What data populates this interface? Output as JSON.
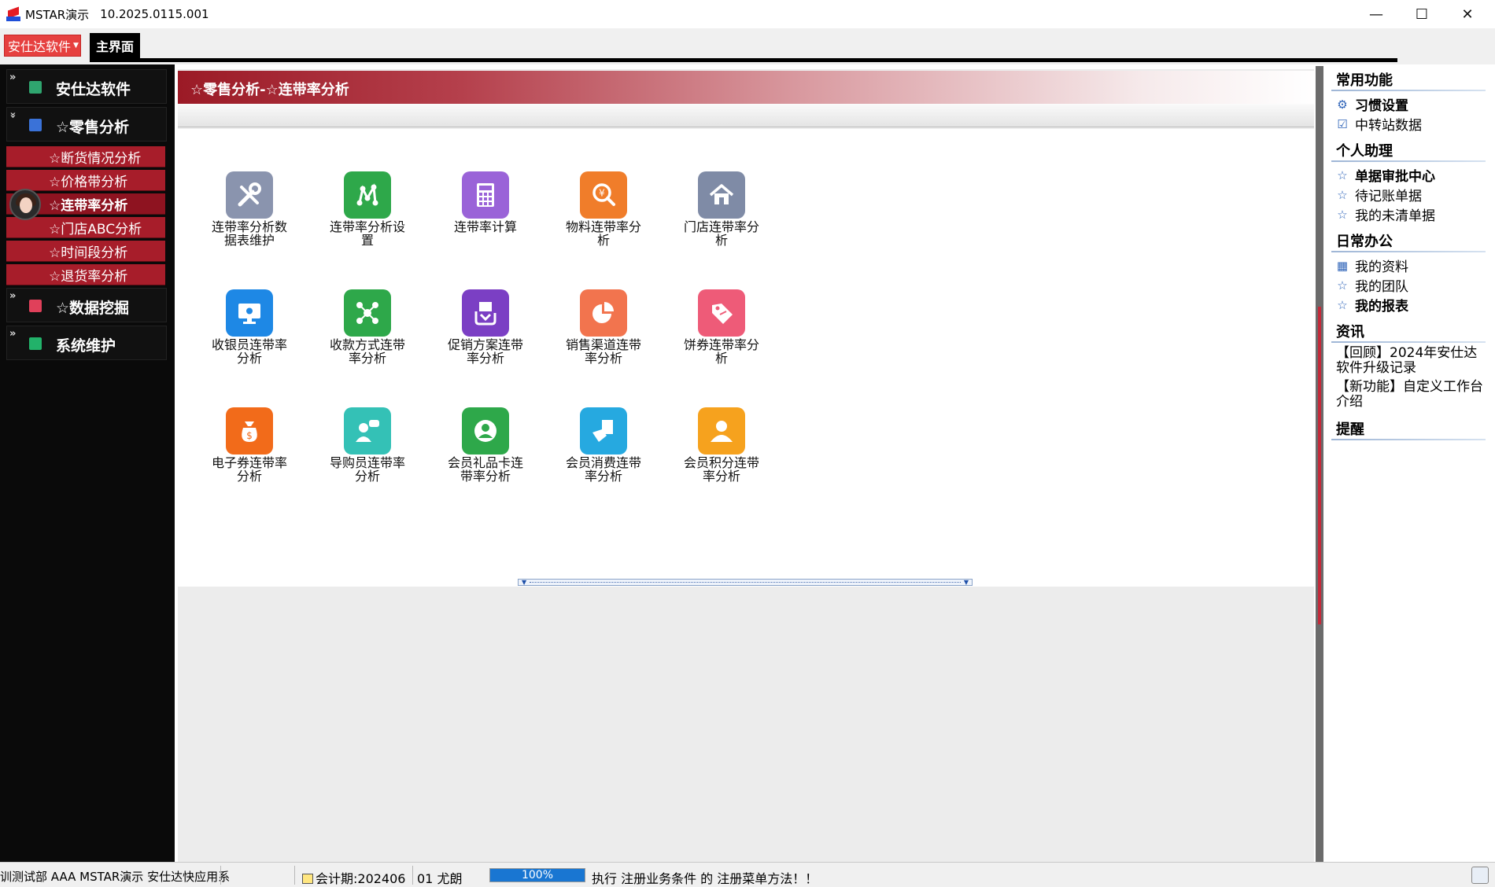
{
  "window": {
    "title": "MSTAR演示",
    "version": "10.2025.0115.001",
    "minimize": "—",
    "maximize": "☐",
    "close": "✕"
  },
  "toolbar": {
    "company_menu": "安仕达软件",
    "main_tab": "主界面"
  },
  "sidebar": {
    "groups": [
      {
        "label": "安仕达软件",
        "icon": "app-icon",
        "color": "#2fa56f"
      },
      {
        "label": "☆零售分析",
        "icon": "chart-icon",
        "color": "#3a72d8"
      },
      {
        "label": "☆数据挖掘",
        "icon": "mining-icon",
        "color": "#e0405a"
      },
      {
        "label": "系统维护",
        "icon": "maintenance-icon",
        "color": "#22b26a"
      }
    ],
    "items": [
      {
        "label": "☆断货情况分析"
      },
      {
        "label": "☆价格带分析"
      },
      {
        "label": "☆连带率分析"
      },
      {
        "label": "☆门店ABC分析"
      },
      {
        "label": "☆时间段分析"
      },
      {
        "label": "☆退货率分析"
      }
    ],
    "active_item": "☆连带率分析"
  },
  "main": {
    "header_title": "☆零售分析-☆连带率分析",
    "tiles": [
      {
        "label": "连带率分析数据表维护",
        "icon": "tools-icon",
        "color": "#8a94ae"
      },
      {
        "label": "连带率分析设置",
        "icon": "network-icon",
        "color": "#2ea84a"
      },
      {
        "label": "连带率计算",
        "icon": "calculator-icon",
        "color": "#9a63d8"
      },
      {
        "label": "物料连带率分析",
        "icon": "yuan-search-icon",
        "color": "#f07d2a"
      },
      {
        "label": "门店连带率分析",
        "icon": "store-icon",
        "color": "#7f8ba6"
      },
      {
        "label": "收银员连带率分析",
        "icon": "monitor-icon",
        "color": "#1e88e5"
      },
      {
        "label": "收款方式连带率分析",
        "icon": "nodes-icon",
        "color": "#2ea84a"
      },
      {
        "label": "促销方案连带率分析",
        "icon": "hand-cash-icon",
        "color": "#7b3fc4"
      },
      {
        "label": "销售渠道连带率分析",
        "icon": "pie-icon",
        "color": "#f2744e"
      },
      {
        "label": "饼券连带率分析",
        "icon": "tag-icon",
        "color": "#ee5b78"
      },
      {
        "label": "电子券连带率分析",
        "icon": "money-bag-icon",
        "color": "#f26b1a"
      },
      {
        "label": "导购员连带率分析",
        "icon": "guide-icon",
        "color": "#34c1b6"
      },
      {
        "label": "会员礼品卡连带率分析",
        "icon": "member-card-icon",
        "color": "#2ea84a"
      },
      {
        "label": "会员消费连带率分析",
        "icon": "member-spend-icon",
        "color": "#26a9e0"
      },
      {
        "label": "会员积分连带率分析",
        "icon": "member-points-icon",
        "color": "#f6a21e"
      }
    ]
  },
  "right_panel": {
    "sections": [
      {
        "title": "常用功能",
        "items": [
          {
            "label": "习惯设置",
            "icon": "link-gear-icon",
            "bold": true
          },
          {
            "label": "中转站数据",
            "icon": "checkbox-icon",
            "bold": false
          }
        ]
      },
      {
        "title": "个人助理",
        "items": [
          {
            "label": "单据审批中心",
            "icon": "star-icon",
            "bold": true
          },
          {
            "label": "待记账单据",
            "icon": "star-icon",
            "bold": false
          },
          {
            "label": "我的未清单据",
            "icon": "star-icon",
            "bold": false
          }
        ]
      },
      {
        "title": "日常办公",
        "items": [
          {
            "label": "我的资料",
            "icon": "calendar-icon",
            "bold": false
          },
          {
            "label": "我的团队",
            "icon": "star-icon",
            "bold": false
          },
          {
            "label": "我的报表",
            "icon": "star-icon",
            "bold": true
          }
        ]
      }
    ],
    "news_title": "资讯",
    "news": [
      "【回顾】2024年安仕达软件升级记录",
      "【新功能】自定义工作台介绍"
    ],
    "reminder_title": "提醒"
  },
  "statusbar": {
    "left": "训测试部 AAA MSTAR演示 安仕达快应用系",
    "period": "会计期:202406",
    "user": "01 尤朗",
    "progress_percent": 100,
    "progress_label": "100%",
    "message": "执行 注册业务条件 的 注册菜单方法！！"
  }
}
